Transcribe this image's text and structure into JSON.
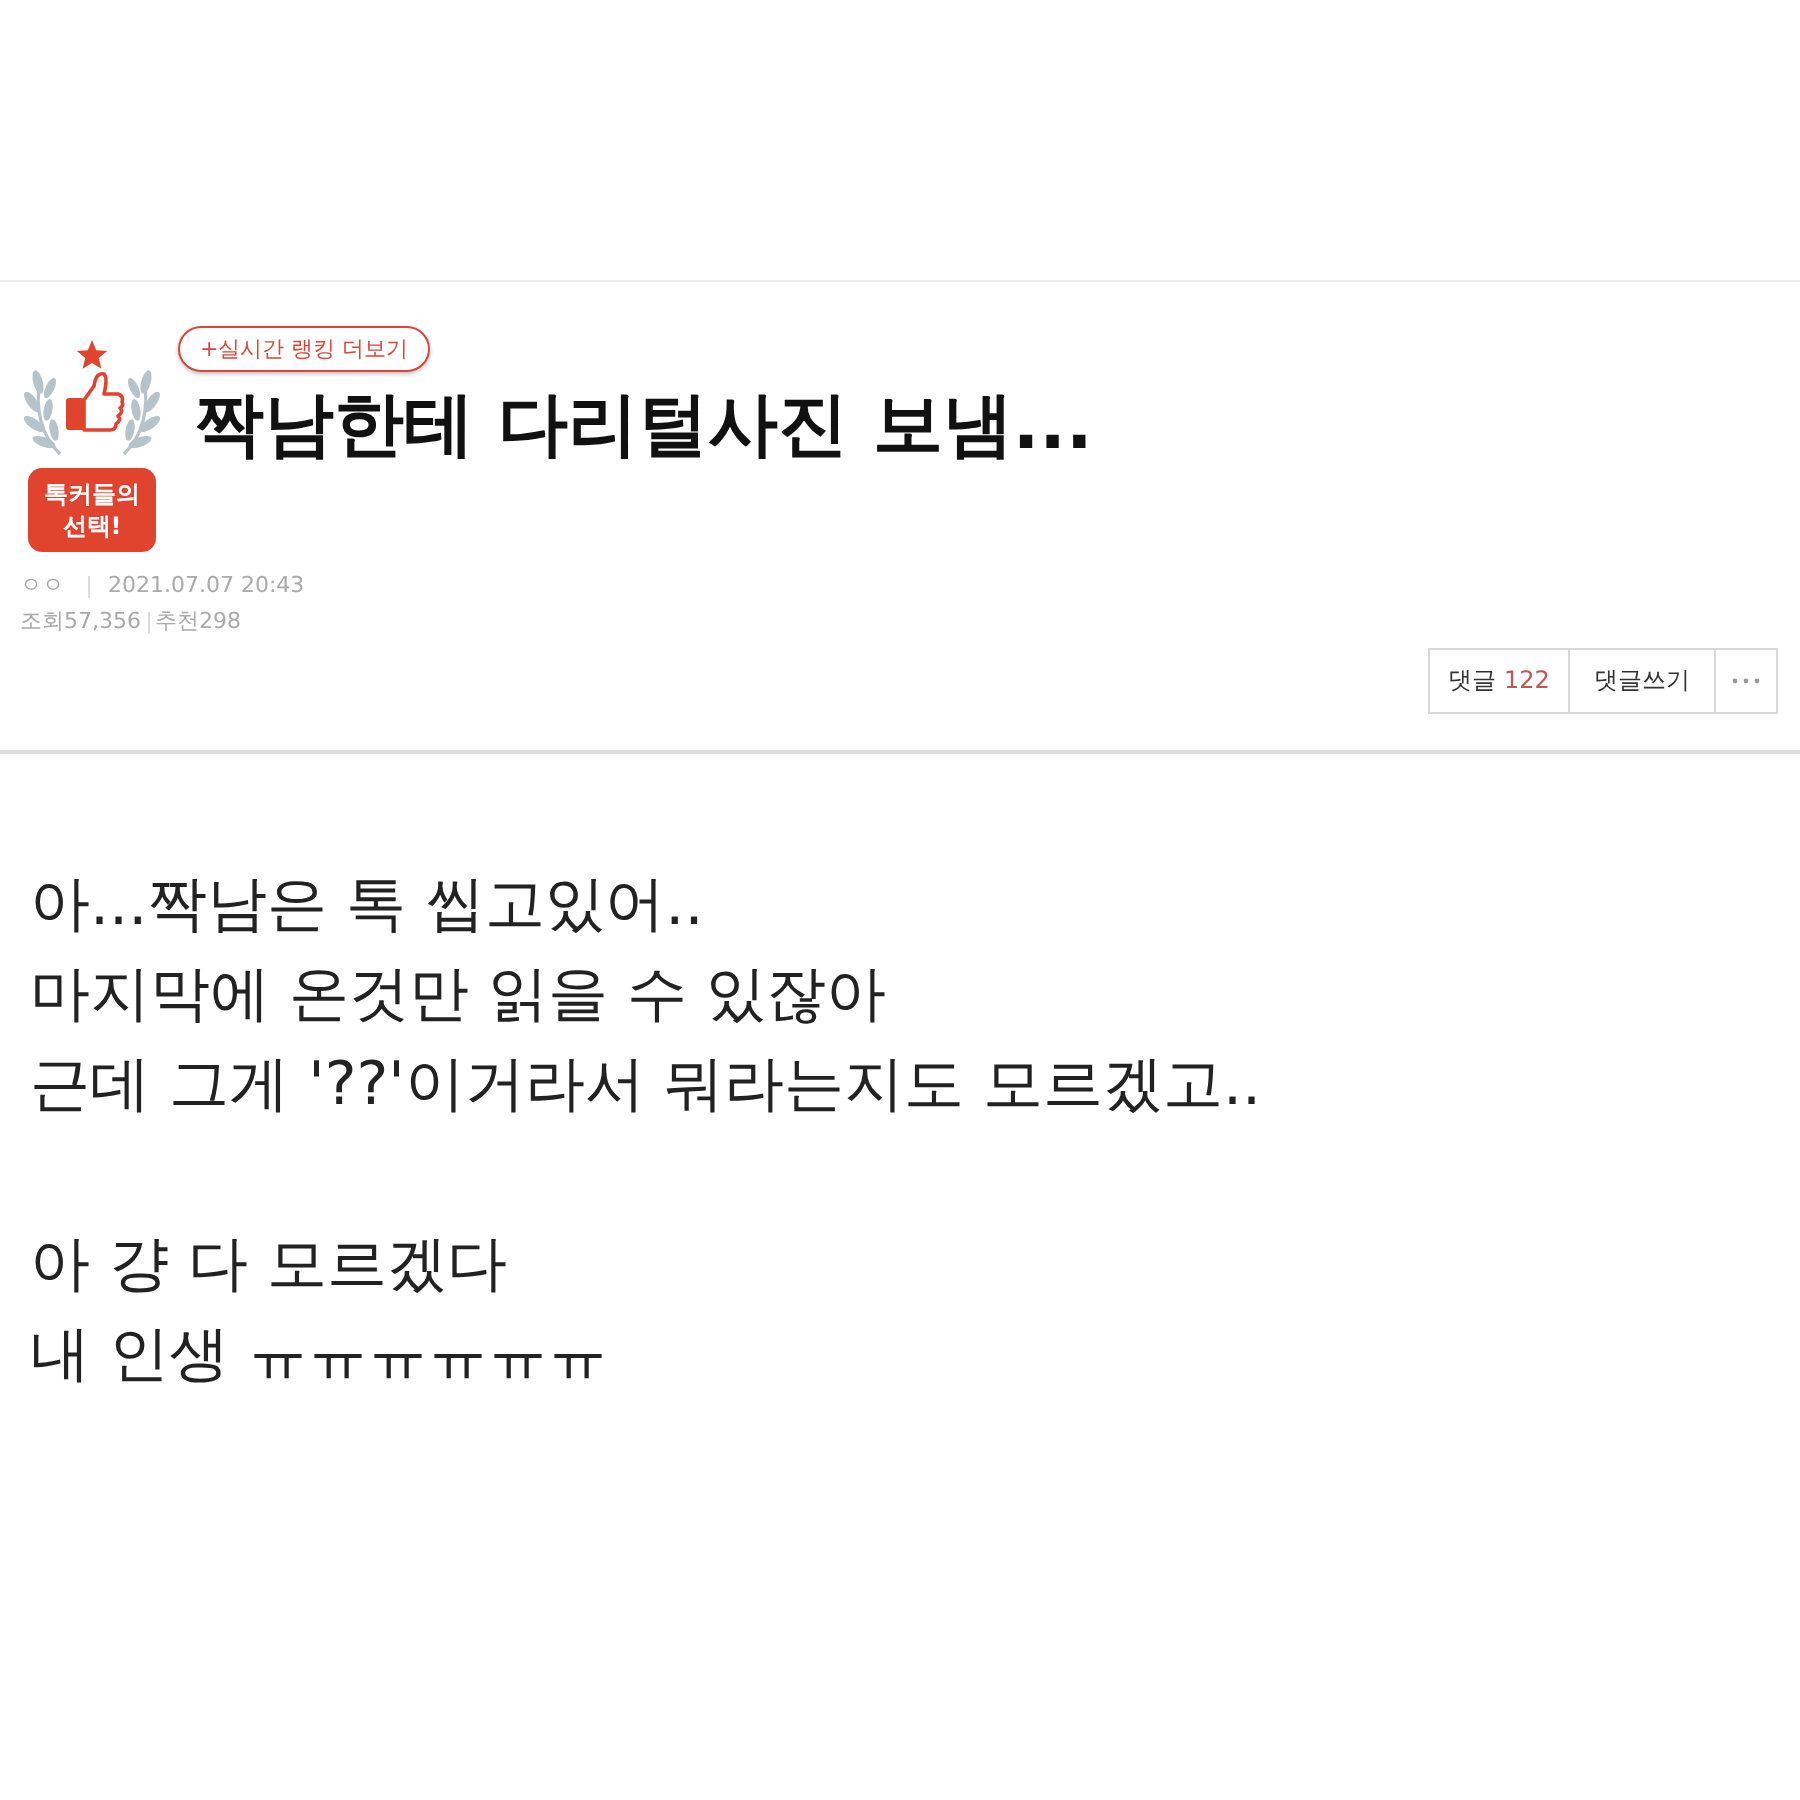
{
  "header": {
    "badge": {
      "label": "톡커들의 선택!"
    },
    "ranking_link": "+실시간 랭킹 더보기",
    "title": "짝남한테 다리털사진 보냄..."
  },
  "meta": {
    "author": "ㅇㅇ",
    "date": "2021.07.07 20:43",
    "views": "조회57,356",
    "recommends": "추천298"
  },
  "actions": {
    "comments": {
      "label": "댓글",
      "count": "122"
    },
    "write_comment": "댓글쓰기"
  },
  "body": {
    "paragraphs": [
      [
        "아...짝남은 톡 씹고있어..",
        "마지막에 온것만 읽을 수 있잖아",
        "근데 그게 '??'이거라서 뭐라는지도 모르겠고.."
      ],
      [
        "아 걍 다 모르겠다",
        "내 인생 ㅠㅠㅠㅠㅠㅠ"
      ]
    ]
  }
}
